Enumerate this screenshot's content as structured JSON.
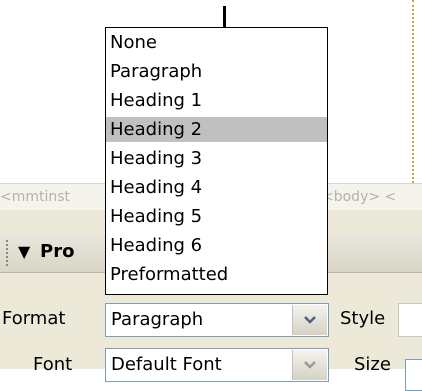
{
  "tag_selector": {
    "left_tag": "<mmtinst",
    "right_tag": "<body> <"
  },
  "properties": {
    "title": "Pro",
    "format_label": "Format",
    "format_value": "Paragraph",
    "style_label": "Style",
    "font_label": "Font",
    "font_value": "Default Font",
    "size_label": "Size"
  },
  "format_dropdown": {
    "selected": "Heading 2",
    "options": [
      "None",
      "Paragraph",
      "Heading 1",
      "Heading 2",
      "Heading 3",
      "Heading 4",
      "Heading 5",
      "Heading 6",
      "Preformatted"
    ]
  }
}
